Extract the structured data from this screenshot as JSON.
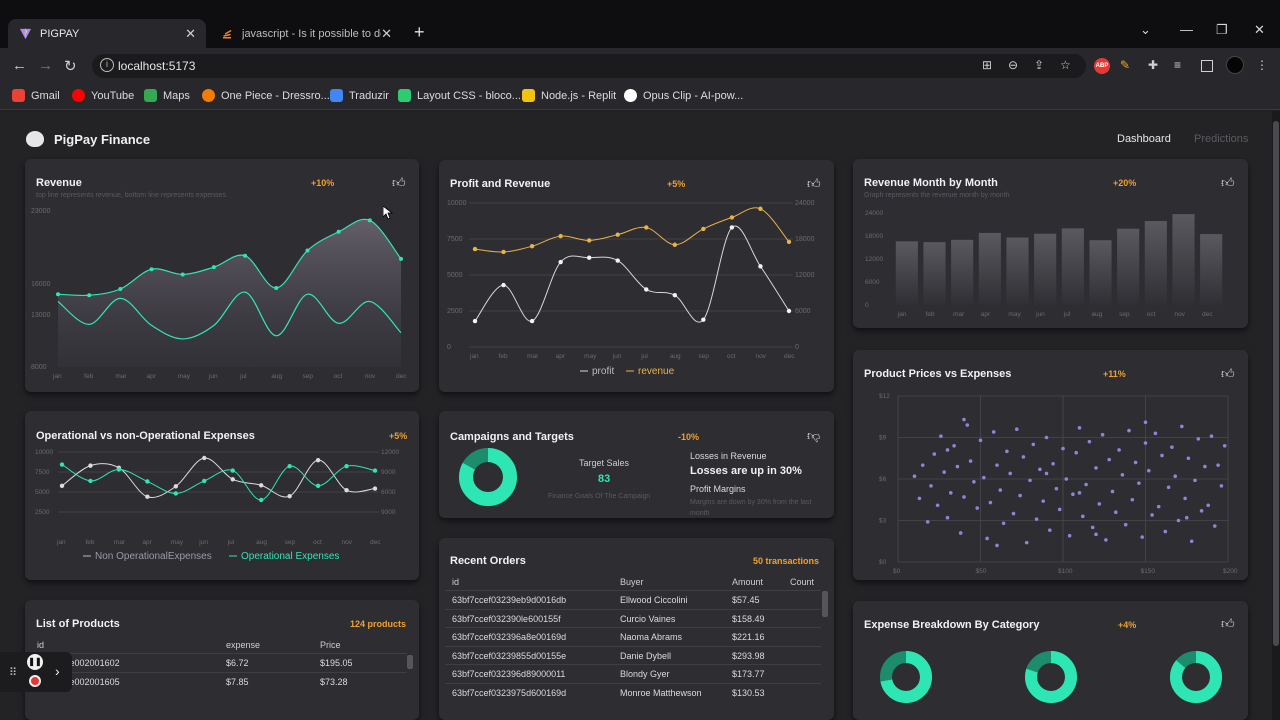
{
  "browser": {
    "tabs": [
      {
        "title": "PIGPAY",
        "active": true
      },
      {
        "title": "javascript - Is it possible to deplo",
        "active": false
      }
    ],
    "url": "localhost:5173",
    "bookmarks": [
      "Gmail",
      "YouTube",
      "Maps",
      "One Piece - Dressro...",
      "Traduzir",
      "Layout CSS - bloco...",
      "Node.js - Replit",
      "Opus Clip - AI-pow..."
    ],
    "bookmark_colors": [
      "#ea4335",
      "#ff0000",
      "#34a853",
      "#f57c00",
      "#4285f4",
      "#2ecc71",
      "#f1c40f",
      "#ffffff"
    ],
    "ext_badge": "ABP"
  },
  "app": {
    "brand": "PigPay Finance",
    "nav": {
      "dashboard": "Dashboard",
      "predictions": "Predictions"
    }
  },
  "colors": {
    "accent": "#2ee6b4",
    "gold": "#f0a030",
    "profit": "#d8d8d8",
    "revenue": "#e8b24a",
    "scatter": "#8b86d8"
  },
  "cards": {
    "revenue": {
      "title": "Revenue",
      "subtitle": "top line represents revenue, bottom line represents expenses",
      "badge": "+10%"
    },
    "profit_revenue": {
      "title": "Profit and Revenue",
      "badge": "+5%"
    },
    "rev_month": {
      "title": "Revenue Month by Month",
      "subtitle": "Graph represents the revenue month by month",
      "badge": "+20%"
    },
    "operational": {
      "title": "Operational vs non-Operational Expenses",
      "badge": "+5%"
    },
    "campaigns": {
      "title": "Campaigns and Targets",
      "badge": "-10%",
      "target_label": "Target Sales",
      "target_value": "83",
      "goals_note": "Finance Goals Of The Campaign",
      "losses_label": "Losses in Revenue",
      "losses_text": "Losses are up in 30%",
      "margins_label": "Profit Margins",
      "margins_note": "Margins are down by 30% from the last month",
      "donut_fraction": 0.83
    },
    "scatter": {
      "title": "Product Prices vs Expenses",
      "badge": "+11%"
    },
    "orders": {
      "title": "Recent Orders",
      "badge": "50 transactions",
      "headers": [
        "id",
        "Buyer",
        "Amount",
        "Count"
      ],
      "rows": [
        [
          "63bf7ccef03239eb9d0016db",
          "Ellwood Ciccolini",
          "$57.45"
        ],
        [
          "63bf7ccef032390le600155f",
          "Curcio Vaines",
          "$158.49"
        ],
        [
          "63bf7ccef032396a8e00169d",
          "Naoma Abrams",
          "$221.16"
        ],
        [
          "63bf7ccef03239855d00155e",
          "Danie Dybell",
          "$293.98"
        ],
        [
          "63bf7ccef032396d89000011",
          "Blondy Gyer",
          "$173.77"
        ],
        [
          "63bf7ccef0323975d600169d",
          "Monroe Matthewson",
          "$130.53"
        ]
      ]
    },
    "products": {
      "title": "List of Products",
      "badge": "124 products",
      "headers": [
        "id",
        "expense",
        "Price"
      ],
      "rows": [
        [
          "9f03239e002001602",
          "$6.72",
          "$195.05"
        ],
        [
          "9f03239e002001605",
          "$7.85",
          "$73.28"
        ]
      ]
    },
    "expense_breakdown": {
      "title": "Expense Breakdown By Category",
      "badge": "+4%",
      "fractions": [
        0.72,
        0.8,
        0.86
      ]
    }
  },
  "chart_data": [
    {
      "type": "area",
      "name": "revenue",
      "categories": [
        "jan",
        "feb",
        "mar",
        "apr",
        "may",
        "jun",
        "jul",
        "aug",
        "sep",
        "oct",
        "nov",
        "dec"
      ],
      "y_ticks": [
        "8000",
        "13000",
        "16000",
        "23000"
      ],
      "ylim": [
        8000,
        23000
      ],
      "series": [
        {
          "values": [
            15000,
            14900,
            15500,
            17400,
            16900,
            17600,
            18700,
            15600,
            19200,
            21000,
            22100,
            18400
          ]
        },
        {
          "values": [
            14300,
            12100,
            14600,
            12000,
            10700,
            12000,
            15200,
            11000,
            15000,
            12200,
            14300,
            11300
          ]
        }
      ]
    },
    {
      "type": "line",
      "name": "profit_revenue",
      "categories": [
        "jan",
        "feb",
        "mar",
        "apr",
        "may",
        "jun",
        "jul",
        "aug",
        "sep",
        "oct",
        "nov",
        "dec"
      ],
      "y_ticks_left": [
        "0",
        "2500",
        "5000",
        "7500",
        "10000"
      ],
      "y_ticks_right": [
        "0",
        "6000",
        "12000",
        "18000",
        "24000"
      ],
      "ylim": [
        0,
        10000
      ],
      "legend": [
        "profit",
        "revenue"
      ],
      "series": [
        {
          "name": "profit",
          "values": [
            1800,
            4300,
            1800,
            5900,
            6200,
            6000,
            4000,
            3600,
            1900,
            8300,
            5600,
            2500
          ]
        },
        {
          "name": "revenue",
          "values": [
            6800,
            6600,
            7000,
            7700,
            7400,
            7800,
            8300,
            7100,
            8200,
            9000,
            9600,
            7300
          ]
        }
      ]
    },
    {
      "type": "bar",
      "name": "rev_month",
      "categories": [
        "jan",
        "feb",
        "mar",
        "apr",
        "may",
        "jun",
        "jul",
        "aug",
        "sep",
        "oct",
        "nov",
        "dec"
      ],
      "y_ticks": [
        "0",
        "6000",
        "12000",
        "18000",
        "24000"
      ],
      "ylim": [
        0,
        24000
      ],
      "values": [
        16600,
        16400,
        17000,
        18800,
        17600,
        18600,
        20000,
        16900,
        19900,
        21900,
        23700,
        18500
      ]
    },
    {
      "type": "line",
      "name": "operational",
      "categories": [
        "jan",
        "feb",
        "mar",
        "apr",
        "may",
        "jun",
        "jul",
        "aug",
        "sep",
        "oct",
        "nov",
        "dec"
      ],
      "y_ticks_left": [
        "2500",
        "5000",
        "7500",
        "10000"
      ],
      "y_ticks_right": [
        "9000",
        "6000",
        "9000",
        "12000"
      ],
      "ylim": [
        0,
        11000
      ],
      "legend": [
        "Non OperationalExpenses",
        "Operational Expenses"
      ],
      "series": [
        {
          "name": "Non OperationalExpenses",
          "values": [
            4800,
            8500,
            8100,
            2800,
            4700,
            9900,
            6000,
            4900,
            2900,
            9500,
            4000,
            4300
          ]
        },
        {
          "name": "Operational Expenses",
          "values": [
            8700,
            5700,
            7800,
            5600,
            3400,
            5700,
            7600,
            2200,
            8400,
            4800,
            8400,
            7600
          ]
        }
      ]
    },
    {
      "type": "scatter",
      "name": "scatter",
      "x_ticks": [
        "$0",
        "$50",
        "$100",
        "$150",
        "$200"
      ],
      "y_ticks": [
        "$0",
        "$3",
        "$6",
        "$9",
        "$12"
      ],
      "xlim": [
        0,
        200
      ],
      "ylim": [
        0,
        12
      ],
      "points": [
        [
          10,
          6.2
        ],
        [
          13,
          4.6
        ],
        [
          15,
          7
        ],
        [
          18,
          2.9
        ],
        [
          20,
          5.5
        ],
        [
          22,
          7.8
        ],
        [
          24,
          4.1
        ],
        [
          26,
          9.1
        ],
        [
          28,
          6.5
        ],
        [
          30,
          3.2
        ],
        [
          32,
          5
        ],
        [
          34,
          8.4
        ],
        [
          36,
          6.9
        ],
        [
          38,
          2.1
        ],
        [
          40,
          4.7
        ],
        [
          42,
          9.9
        ],
        [
          44,
          7.3
        ],
        [
          46,
          5.8
        ],
        [
          48,
          3.9
        ],
        [
          50,
          8.8
        ],
        [
          52,
          6.1
        ],
        [
          54,
          1.7
        ],
        [
          56,
          4.3
        ],
        [
          58,
          9.4
        ],
        [
          60,
          7
        ],
        [
          62,
          5.2
        ],
        [
          64,
          2.8
        ],
        [
          66,
          8
        ],
        [
          68,
          6.4
        ],
        [
          70,
          3.5
        ],
        [
          72,
          9.6
        ],
        [
          74,
          4.8
        ],
        [
          76,
          7.6
        ],
        [
          78,
          1.4
        ],
        [
          80,
          5.9
        ],
        [
          82,
          8.5
        ],
        [
          84,
          3.1
        ],
        [
          86,
          6.7
        ],
        [
          88,
          4.4
        ],
        [
          90,
          9
        ],
        [
          92,
          2.3
        ],
        [
          94,
          7.1
        ],
        [
          96,
          5.3
        ],
        [
          98,
          3.8
        ],
        [
          100,
          8.2
        ],
        [
          102,
          6
        ],
        [
          104,
          1.9
        ],
        [
          106,
          4.9
        ],
        [
          108,
          7.9
        ],
        [
          110,
          9.7
        ],
        [
          112,
          3.3
        ],
        [
          114,
          5.6
        ],
        [
          116,
          8.7
        ],
        [
          118,
          2.5
        ],
        [
          120,
          6.8
        ],
        [
          122,
          4.2
        ],
        [
          124,
          9.2
        ],
        [
          126,
          1.6
        ],
        [
          128,
          7.4
        ],
        [
          130,
          5.1
        ],
        [
          132,
          3.6
        ],
        [
          134,
          8.1
        ],
        [
          136,
          6.3
        ],
        [
          138,
          2.7
        ],
        [
          140,
          9.5
        ],
        [
          142,
          4.5
        ],
        [
          144,
          7.2
        ],
        [
          146,
          5.7
        ],
        [
          148,
          1.8
        ],
        [
          150,
          8.6
        ],
        [
          152,
          6.6
        ],
        [
          154,
          3.4
        ],
        [
          156,
          9.3
        ],
        [
          158,
          4
        ],
        [
          160,
          7.7
        ],
        [
          162,
          2.2
        ],
        [
          164,
          5.4
        ],
        [
          166,
          8.3
        ],
        [
          168,
          6.2
        ],
        [
          170,
          3
        ],
        [
          172,
          9.8
        ],
        [
          174,
          4.6
        ],
        [
          176,
          7.5
        ],
        [
          178,
          1.5
        ],
        [
          180,
          5.9
        ],
        [
          182,
          8.9
        ],
        [
          184,
          3.7
        ],
        [
          186,
          6.9
        ],
        [
          188,
          4.1
        ],
        [
          190,
          9.1
        ],
        [
          192,
          2.6
        ],
        [
          194,
          7
        ],
        [
          196,
          5.5
        ],
        [
          198,
          8.4
        ],
        [
          60,
          1.2
        ],
        [
          120,
          2
        ],
        [
          40,
          10.3
        ],
        [
          150,
          10.1
        ],
        [
          90,
          6.4
        ],
        [
          30,
          8.1
        ],
        [
          175,
          3.2
        ],
        [
          110,
          5
        ]
      ]
    }
  ]
}
